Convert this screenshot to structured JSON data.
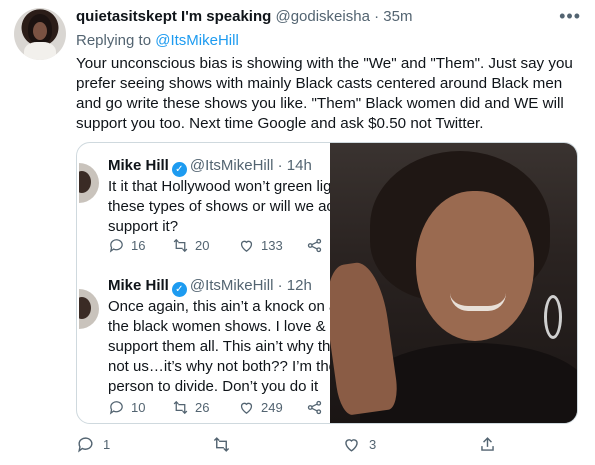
{
  "tweet": {
    "author_name": "quietasitskept I'm speaking",
    "author_handle": "@godiskeisha",
    "separator": "·",
    "time": "35m",
    "replying_prefix": "Replying to",
    "replying_to": "@ItsMikeHill",
    "text": "Your unconscious bias is showing with the \"We\" and \"Them\". Just say you prefer seeing shows with mainly Black casts centered around Black men and go write these shows you like. \"Them\" Black women did and WE will support you too. Next time Google and ask $0.50 not Twitter.",
    "actions": {
      "reply": "1",
      "retweet": "",
      "like": "3",
      "share": ""
    }
  },
  "quoted": [
    {
      "name": "Mike Hill",
      "handle": "@ItsMikeHill",
      "separator": "·",
      "time": "14h",
      "lines": [
        "It it that Hollywood won’t green light",
        "these types of shows or will we actu",
        "support it?"
      ],
      "reply_count": "16",
      "retweet_count": "20",
      "like_count": "133"
    },
    {
      "name": "Mike Hill",
      "handle": "@ItsMikeHill",
      "separator": "·",
      "time": "12h",
      "lines": [
        "Once again, this ain’t a knock on any",
        "the black women shows. I love &",
        "support them all. This ain’t why ther",
        "not us…it’s why not both?? I’m the la",
        "person to divide. Don’t you do it"
      ],
      "reply_count": "10",
      "retweet_count": "26",
      "like_count": "249"
    }
  ],
  "icons": {
    "reply": "reply-icon",
    "retweet": "retweet-icon",
    "like": "heart-icon",
    "share": "share-icon",
    "more": "more-icon",
    "verified": "verified-icon"
  },
  "colors": {
    "link": "#1d9bf0",
    "muted": "#536471",
    "text": "#0f1419",
    "border": "#cfd9de"
  }
}
